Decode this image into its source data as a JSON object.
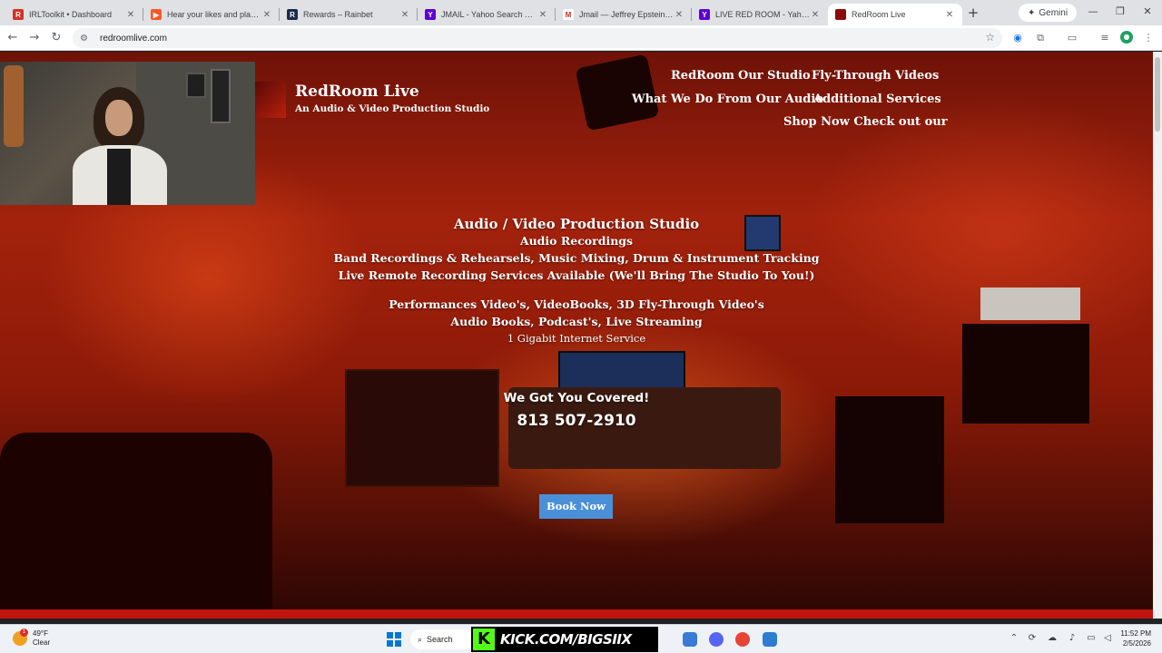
{
  "browser": {
    "tabs": [
      {
        "title": "IRLToolkit • Dashboard",
        "icon": "irltoolkit-favicon",
        "color": "#d93025"
      },
      {
        "title": "Hear your likes and playlists",
        "icon": "music-favicon",
        "color": "#ff5722"
      },
      {
        "title": "Rewards – Rainbet",
        "icon": "rainbet-favicon",
        "color": "#1a2b4c"
      },
      {
        "title": "JMAIL - Yahoo Search Results",
        "icon": "yahoo-favicon",
        "color": "#6001d2"
      },
      {
        "title": "Jmail — Jeffrey Epstein's Ema",
        "icon": "jmail-favicon",
        "color": "#ffffff"
      },
      {
        "title": "LIVE RED ROOM - Yahoo Sear",
        "icon": "yahoo-favicon",
        "color": "#6001d2"
      },
      {
        "title": "RedRoom Live",
        "icon": "redroom-favicon",
        "color": "#8b0a0a"
      }
    ],
    "new_tab_label": "+",
    "gemini_label": "Gemini",
    "url": "redroomlive.com"
  },
  "site": {
    "brand": "RedRoom Live",
    "tagline": "An Audio & Video Production Studio",
    "nav": {
      "redroom": "RedRoom",
      "our_studio": "Our Studio",
      "fly_through": "Fly-Through Videos",
      "what_we_do": "What We Do From Our Audio",
      "additional": "Additional Services",
      "shop": "Shop Now Check out our"
    },
    "hero": {
      "title": "Audio / Video Production Studio",
      "line1": "Audio Recordings",
      "line2": "Band Recordings & Rehearsels, Music Mixing, Drum & Instrument Tracking",
      "line3": "Live Remote Recording Services Available (We'll Bring The Studio To You!)",
      "line4": "Performances Video's, VideoBooks, 3D Fly-Through Video's",
      "line5": "Audio Books, Podcast's, Live Streaming",
      "line6": "1 Gigabit Internet Service",
      "covered": "We Got You Covered!",
      "phone": "813 507-2910",
      "book_button": "Book Now"
    },
    "accent_color": "#c0140e",
    "button_color": "#4a90d9"
  },
  "taskbar": {
    "weather_temp": "49°F",
    "weather_cond": "Clear",
    "weather_badge": "1",
    "search_label": "Search",
    "kick_text": "KICK.COM/BIGSIIX",
    "time": "11:52 PM",
    "date": "2/5/2026"
  }
}
